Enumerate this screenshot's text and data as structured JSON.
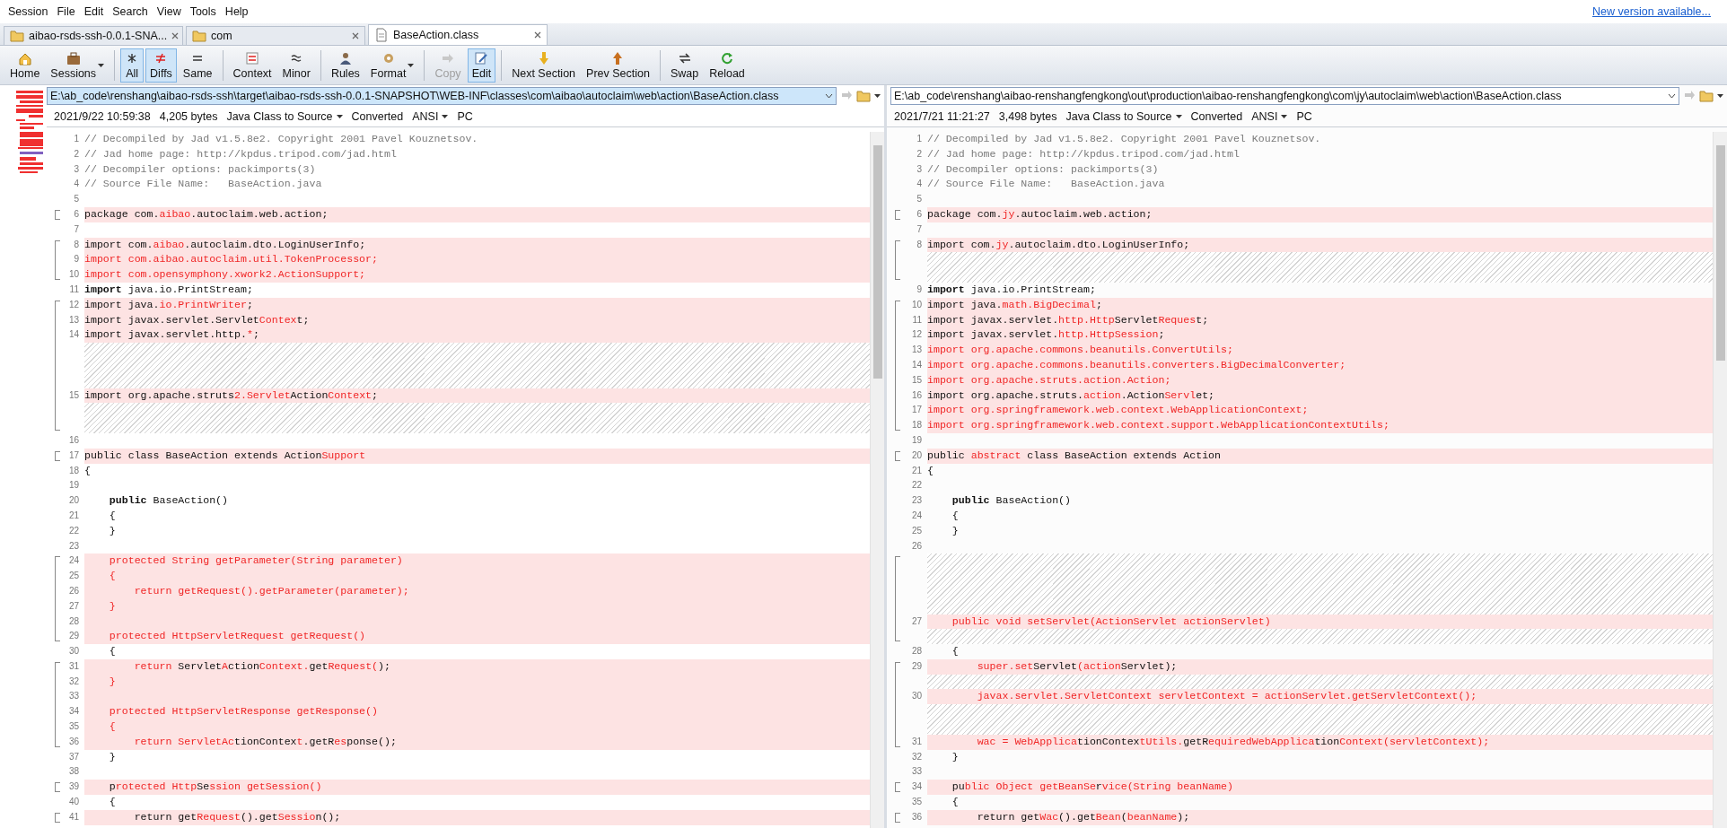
{
  "menu": [
    "Session",
    "File",
    "Edit",
    "Search",
    "View",
    "Tools",
    "Help"
  ],
  "update_link": "New version available...",
  "tabs": [
    {
      "label": "aibao-rsds-ssh-0.0.1-SNA...",
      "selected": false,
      "kind": "folder"
    },
    {
      "label": "com",
      "selected": false,
      "kind": "folder"
    },
    {
      "label": "BaseAction.class",
      "selected": true,
      "kind": "file"
    }
  ],
  "toolbar": [
    {
      "label": "Home",
      "selected": false,
      "disabled": false
    },
    {
      "label": "Sessions",
      "selected": false,
      "disabled": false,
      "dropdown": true
    },
    {
      "label": "All",
      "selected": true,
      "disabled": false,
      "group_start": true
    },
    {
      "label": "Diffs",
      "selected": true,
      "disabled": false
    },
    {
      "label": "Same",
      "selected": false,
      "disabled": false
    },
    {
      "label": "Context",
      "selected": false,
      "disabled": false,
      "group_start": true
    },
    {
      "label": "Minor",
      "selected": false,
      "disabled": false
    },
    {
      "label": "Rules",
      "selected": false,
      "disabled": false,
      "group_start": true
    },
    {
      "label": "Format",
      "selected": false,
      "disabled": false,
      "dropdown": true
    },
    {
      "label": "Copy",
      "selected": false,
      "disabled": true,
      "group_start": true
    },
    {
      "label": "Edit",
      "selected": true,
      "disabled": false
    },
    {
      "label": "Next Section",
      "selected": false,
      "disabled": false,
      "group_start": true
    },
    {
      "label": "Prev Section",
      "selected": false,
      "disabled": false
    },
    {
      "label": "Swap",
      "selected": false,
      "disabled": false,
      "group_start": true
    },
    {
      "label": "Reload",
      "selected": false,
      "disabled": false
    }
  ],
  "panes": [
    {
      "path": "E:\\ab_code\\renshang\\aibao-rsds-ssh\\target\\aibao-rsds-ssh-0.0.1-SNAPSHOT\\WEB-INF\\classes\\com\\aibao\\autoclaim\\web\\action\\BaseAction.class",
      "focused": true,
      "date": "2021/9/22 10:59:38",
      "size": "4,205 bytes",
      "format": "Java Class to Source",
      "status": "Converted",
      "encoding": "ANSI",
      "line_ending": "PC",
      "lines": [
        {
          "kind": "line",
          "number": "1",
          "differs": false,
          "parts": [
            {
              "text": "// Decompiled by Jad v1.5.8e2. Copyright 2001 Pavel Kouznetsov.",
              "kind": "comment"
            }
          ]
        },
        {
          "kind": "line",
          "number": "2",
          "differs": false,
          "parts": [
            {
              "text": "// Jad home page: http://kpdus.tripod.com/jad.html",
              "kind": "comment"
            }
          ]
        },
        {
          "kind": "line",
          "number": "3",
          "differs": false,
          "parts": [
            {
              "text": "// Decompiler options: packimports(3)",
              "kind": "comment"
            }
          ]
        },
        {
          "kind": "line",
          "number": "4",
          "differs": false,
          "parts": [
            {
              "text": "// Source File Name:   BaseAction.java",
              "kind": "comment"
            }
          ]
        },
        {
          "kind": "line",
          "number": "5",
          "differs": false
        },
        {
          "kind": "line",
          "number": "6",
          "differs": true,
          "parts": [
            {
              "text": "package com."
            },
            {
              "text": "aibao",
              "kind": "changed"
            },
            {
              "text": ".autoclaim.web.action;"
            }
          ]
        },
        {
          "kind": "line",
          "number": "7",
          "differs": false
        },
        {
          "kind": "line",
          "number": "8",
          "differs": true,
          "parts": [
            {
              "text": "import com."
            },
            {
              "text": "aibao",
              "kind": "changed"
            },
            {
              "text": ".autoclaim.dto.LoginUserInfo;"
            }
          ]
        },
        {
          "kind": "line",
          "number": "9",
          "differs": true,
          "parts": [
            {
              "text": "import com.aibao.autoclaim.util.TokenProcessor;",
              "kind": "changed"
            }
          ]
        },
        {
          "kind": "line",
          "number": "10",
          "differs": true,
          "parts": [
            {
              "text": "import com.opensymphony.xwork2.ActionSupport;",
              "kind": "changed"
            }
          ]
        },
        {
          "kind": "line",
          "number": "11",
          "differs": false,
          "parts": [
            {
              "text": "import",
              "kind": "keyword"
            },
            {
              "text": " java.io.PrintStream;"
            }
          ]
        },
        {
          "kind": "line",
          "number": "12",
          "differs": true,
          "parts": [
            {
              "text": "import java."
            },
            {
              "text": "io.PrintWriter",
              "kind": "changed"
            },
            {
              "text": ";"
            }
          ]
        },
        {
          "kind": "line",
          "number": "13",
          "differs": true,
          "parts": [
            {
              "text": "import javax.servlet.Servlet"
            },
            {
              "text": "Contex",
              "kind": "changed"
            },
            {
              "text": "t;"
            }
          ]
        },
        {
          "kind": "line",
          "number": "14",
          "differs": true,
          "parts": [
            {
              "text": "import javax.servlet.http."
            },
            {
              "text": "*",
              "kind": "changed"
            },
            {
              "text": ";"
            }
          ]
        },
        {
          "kind": "gap"
        },
        {
          "kind": "gap"
        },
        {
          "kind": "gap"
        },
        {
          "kind": "line",
          "number": "15",
          "differs": true,
          "parts": [
            {
              "text": "import org.apache.struts"
            },
            {
              "text": "2.Servlet",
              "kind": "changed"
            },
            {
              "text": "Action"
            },
            {
              "text": "Context",
              "kind": "changed"
            },
            {
              "text": ";"
            }
          ]
        },
        {
          "kind": "gap"
        },
        {
          "kind": "gap"
        },
        {
          "kind": "line",
          "number": "16",
          "differs": false
        },
        {
          "kind": "line",
          "number": "17",
          "differs": true,
          "parts": [
            {
              "text": "public class BaseAction extends Action"
            },
            {
              "text": "Support",
              "kind": "changed"
            }
          ]
        },
        {
          "kind": "line",
          "number": "18",
          "differs": false,
          "parts": [
            {
              "text": "{"
            }
          ]
        },
        {
          "kind": "line",
          "number": "19",
          "differs": false
        },
        {
          "kind": "line",
          "number": "20",
          "differs": false,
          "parts": [
            {
              "text": "    public",
              "kind": "keyword"
            },
            {
              "text": " BaseAction()"
            }
          ]
        },
        {
          "kind": "line",
          "number": "21",
          "differs": false,
          "parts": [
            {
              "text": "    {"
            }
          ]
        },
        {
          "kind": "line",
          "number": "22",
          "differs": false,
          "parts": [
            {
              "text": "    }"
            }
          ]
        },
        {
          "kind": "line",
          "number": "23",
          "differs": false
        },
        {
          "kind": "line",
          "number": "24",
          "differs": true,
          "parts": [
            {
              "text": "    protected String getParameter(String parameter)",
              "kind": "changed"
            }
          ]
        },
        {
          "kind": "line",
          "number": "25",
          "differs": true,
          "parts": [
            {
              "text": "    {",
              "kind": "changed"
            }
          ]
        },
        {
          "kind": "line",
          "number": "26",
          "differs": true,
          "parts": [
            {
              "text": "        return getRequest().getParameter(parameter);",
              "kind": "changed"
            }
          ]
        },
        {
          "kind": "line",
          "number": "27",
          "differs": true,
          "parts": [
            {
              "text": "    }",
              "kind": "changed"
            }
          ]
        },
        {
          "kind": "line",
          "number": "28",
          "differs": true
        },
        {
          "kind": "line",
          "number": "29",
          "differs": true,
          "parts": [
            {
              "text": "    protected HttpServletRequest getRequest()",
              "kind": "changed"
            }
          ]
        },
        {
          "kind": "line",
          "number": "30",
          "differs": false,
          "parts": [
            {
              "text": "    {"
            }
          ]
        },
        {
          "kind": "line",
          "number": "31",
          "differs": true,
          "parts": [
            {
              "text": "        return",
              "kind": "changed"
            },
            {
              "text": " Servlet"
            },
            {
              "text": "A",
              "kind": "changed"
            },
            {
              "text": "ction"
            },
            {
              "text": "Context.",
              "kind": "changed"
            },
            {
              "text": "get"
            },
            {
              "text": "Request(",
              "kind": "changed"
            },
            {
              "text": ");"
            }
          ]
        },
        {
          "kind": "line",
          "number": "32",
          "differs": true,
          "parts": [
            {
              "text": "    }",
              "kind": "changed"
            }
          ]
        },
        {
          "kind": "line",
          "number": "33",
          "differs": true
        },
        {
          "kind": "line",
          "number": "34",
          "differs": true,
          "parts": [
            {
              "text": "    protected HttpServletResponse getResponse()",
              "kind": "changed"
            }
          ]
        },
        {
          "kind": "line",
          "number": "35",
          "differs": true,
          "parts": [
            {
              "text": "    {",
              "kind": "changed"
            }
          ]
        },
        {
          "kind": "line",
          "number": "36",
          "differs": true,
          "parts": [
            {
              "text": "        return ServletAc",
              "kind": "changed"
            },
            {
              "text": "tionContex"
            },
            {
              "text": "t",
              "kind": "changed"
            },
            {
              "text": ".getR"
            },
            {
              "text": "es",
              "kind": "changed"
            },
            {
              "text": "ponse();"
            }
          ]
        },
        {
          "kind": "line",
          "number": "37",
          "differs": false,
          "parts": [
            {
              "text": "    }"
            }
          ]
        },
        {
          "kind": "line",
          "number": "38",
          "differs": false
        },
        {
          "kind": "line",
          "number": "39",
          "differs": true,
          "parts": [
            {
              "text": "    p"
            },
            {
              "text": "rotected Http",
              "kind": "changed"
            },
            {
              "text": "Se"
            },
            {
              "text": "ssion getSession()",
              "kind": "changed"
            }
          ]
        },
        {
          "kind": "line",
          "number": "40",
          "differs": false,
          "parts": [
            {
              "text": "    {"
            }
          ]
        },
        {
          "kind": "line",
          "number": "41",
          "differs": true,
          "parts": [
            {
              "text": "        return get"
            },
            {
              "text": "Request",
              "kind": "changed"
            },
            {
              "text": "().get"
            },
            {
              "text": "Sessio",
              "kind": "changed"
            },
            {
              "text": "n();"
            }
          ]
        }
      ]
    },
    {
      "path": "E:\\ab_code\\renshang\\aibao-renshangfengkong\\out\\production\\aibao-renshangfengkong\\com\\jy\\autoclaim\\web\\action\\BaseAction.class",
      "focused": false,
      "date": "2021/7/21 11:21:27",
      "size": "3,498 bytes",
      "format": "Java Class to Source",
      "status": "Converted",
      "encoding": "ANSI",
      "line_ending": "PC",
      "lines": [
        {
          "kind": "line",
          "number": "1",
          "differs": false,
          "parts": [
            {
              "text": "// Decompiled by Jad v1.5.8e2. Copyright 2001 Pavel Kouznetsov.",
              "kind": "comment"
            }
          ]
        },
        {
          "kind": "line",
          "number": "2",
          "differs": false,
          "parts": [
            {
              "text": "// Jad home page: http://kpdus.tripod.com/jad.html",
              "kind": "comment"
            }
          ]
        },
        {
          "kind": "line",
          "number": "3",
          "differs": false,
          "parts": [
            {
              "text": "// Decompiler options: packimports(3)",
              "kind": "comment"
            }
          ]
        },
        {
          "kind": "line",
          "number": "4",
          "differs": false,
          "parts": [
            {
              "text": "// Source File Name:   BaseAction.java",
              "kind": "comment"
            }
          ]
        },
        {
          "kind": "line",
          "number": "5",
          "differs": false
        },
        {
          "kind": "line",
          "number": "6",
          "differs": true,
          "parts": [
            {
              "text": "package com."
            },
            {
              "text": "jy",
              "kind": "changed"
            },
            {
              "text": ".autoclaim.web.action;"
            }
          ]
        },
        {
          "kind": "line",
          "number": "7",
          "differs": false
        },
        {
          "kind": "line",
          "number": "8",
          "differs": true,
          "parts": [
            {
              "text": "import com."
            },
            {
              "text": "jy",
              "kind": "changed"
            },
            {
              "text": ".autoclaim.dto.LoginUserInfo;"
            }
          ]
        },
        {
          "kind": "gap"
        },
        {
          "kind": "gap"
        },
        {
          "kind": "line",
          "number": "9",
          "differs": false,
          "parts": [
            {
              "text": "import",
              "kind": "keyword"
            },
            {
              "text": " java.io.PrintStream;"
            }
          ]
        },
        {
          "kind": "line",
          "number": "10",
          "differs": true,
          "parts": [
            {
              "text": "import java."
            },
            {
              "text": "math.BigDecimal",
              "kind": "changed"
            },
            {
              "text": ";"
            }
          ]
        },
        {
          "kind": "line",
          "number": "11",
          "differs": true,
          "parts": [
            {
              "text": "import javax.servlet."
            },
            {
              "text": "http.Http",
              "kind": "changed"
            },
            {
              "text": "Servlet"
            },
            {
              "text": "Reques",
              "kind": "changed"
            },
            {
              "text": "t;"
            }
          ]
        },
        {
          "kind": "line",
          "number": "12",
          "differs": true,
          "parts": [
            {
              "text": "import javax.servlet."
            },
            {
              "text": "http.HttpSession",
              "kind": "changed"
            },
            {
              "text": ";"
            }
          ]
        },
        {
          "kind": "line",
          "number": "13",
          "differs": true,
          "parts": [
            {
              "text": "import org.apache.commons.beanutils.ConvertUtils;",
              "kind": "changed"
            }
          ]
        },
        {
          "kind": "line",
          "number": "14",
          "differs": true,
          "parts": [
            {
              "text": "import org.apache.commons.beanutils.converters.BigDecimalConverter;",
              "kind": "changed"
            }
          ]
        },
        {
          "kind": "line",
          "number": "15",
          "differs": true,
          "parts": [
            {
              "text": "import org.apache.struts.action.Action;",
              "kind": "changed"
            }
          ]
        },
        {
          "kind": "line",
          "number": "16",
          "differs": true,
          "parts": [
            {
              "text": "import org.apache.struts."
            },
            {
              "text": "action",
              "kind": "changed"
            },
            {
              "text": ".Action"
            },
            {
              "text": "Servl",
              "kind": "changed"
            },
            {
              "text": "et;"
            }
          ]
        },
        {
          "kind": "line",
          "number": "17",
          "differs": true,
          "parts": [
            {
              "text": "import org.springframework.web.context.WebApplicationContext;",
              "kind": "changed"
            }
          ]
        },
        {
          "kind": "line",
          "number": "18",
          "differs": true,
          "parts": [
            {
              "text": "import org.springframework.web.context.support.WebApplicationContextUtils;",
              "kind": "changed"
            }
          ]
        },
        {
          "kind": "line",
          "number": "19",
          "differs": false
        },
        {
          "kind": "line",
          "number": "20",
          "differs": true,
          "parts": [
            {
              "text": "public "
            },
            {
              "text": "abstract",
              "kind": "changed"
            },
            {
              "text": " class BaseAction extends Action"
            }
          ]
        },
        {
          "kind": "line",
          "number": "21",
          "differs": false,
          "parts": [
            {
              "text": "{"
            }
          ]
        },
        {
          "kind": "line",
          "number": "22",
          "differs": false
        },
        {
          "kind": "line",
          "number": "23",
          "differs": false,
          "parts": [
            {
              "text": "    public",
              "kind": "keyword"
            },
            {
              "text": " BaseAction()"
            }
          ]
        },
        {
          "kind": "line",
          "number": "24",
          "differs": false,
          "parts": [
            {
              "text": "    {"
            }
          ]
        },
        {
          "kind": "line",
          "number": "25",
          "differs": false,
          "parts": [
            {
              "text": "    }"
            }
          ]
        },
        {
          "kind": "line",
          "number": "26",
          "differs": false
        },
        {
          "kind": "gap"
        },
        {
          "kind": "gap"
        },
        {
          "kind": "gap"
        },
        {
          "kind": "gap"
        },
        {
          "kind": "line",
          "number": "27",
          "differs": true,
          "parts": [
            {
              "text": "    public void setServlet(ActionServlet actionServlet)",
              "kind": "changed"
            }
          ]
        },
        {
          "kind": "gap"
        },
        {
          "kind": "line",
          "number": "28",
          "differs": false,
          "parts": [
            {
              "text": "    {"
            }
          ]
        },
        {
          "kind": "line",
          "number": "29",
          "differs": true,
          "parts": [
            {
              "text": "        super.set",
              "kind": "changed"
            },
            {
              "text": "Servlet"
            },
            {
              "text": "(action",
              "kind": "changed"
            },
            {
              "text": "Servlet"
            },
            {
              "text": ");"
            }
          ]
        },
        {
          "kind": "gap"
        },
        {
          "kind": "line",
          "number": "30",
          "differs": true,
          "parts": [
            {
              "text": "        javax.servlet.ServletContext servletContext = actionServlet.getServletContext();",
              "kind": "changed"
            }
          ]
        },
        {
          "kind": "gap"
        },
        {
          "kind": "gap"
        },
        {
          "kind": "line",
          "number": "31",
          "differs": true,
          "parts": [
            {
              "text": "        wac = WebApplica",
              "kind": "changed"
            },
            {
              "text": "tionContex"
            },
            {
              "text": "tUtils.",
              "kind": "changed"
            },
            {
              "text": "getR"
            },
            {
              "text": "equiredWebApplica",
              "kind": "changed"
            },
            {
              "text": "tion"
            },
            {
              "text": "Context(servletContext);",
              "kind": "changed"
            }
          ]
        },
        {
          "kind": "line",
          "number": "32",
          "differs": false,
          "parts": [
            {
              "text": "    }"
            }
          ]
        },
        {
          "kind": "line",
          "number": "33",
          "differs": false
        },
        {
          "kind": "line",
          "number": "34",
          "differs": true,
          "parts": [
            {
              "text": "    pu"
            },
            {
              "text": "blic Object getBeanSe",
              "kind": "changed"
            },
            {
              "text": "r"
            },
            {
              "text": "vice(String beanName)",
              "kind": "changed"
            }
          ]
        },
        {
          "kind": "line",
          "number": "35",
          "differs": false,
          "parts": [
            {
              "text": "    {"
            }
          ]
        },
        {
          "kind": "line",
          "number": "36",
          "differs": true,
          "parts": [
            {
              "text": "        return get"
            },
            {
              "text": "Wac",
              "kind": "changed"
            },
            {
              "text": "().get"
            },
            {
              "text": "Bean",
              "kind": "changed"
            },
            {
              "text": "("
            },
            {
              "text": "beanName",
              "kind": "changed"
            },
            {
              "text": ");"
            }
          ]
        }
      ]
    }
  ]
}
